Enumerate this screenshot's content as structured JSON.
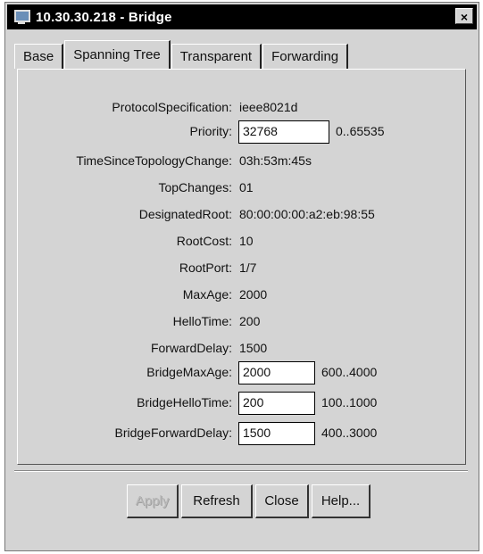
{
  "window": {
    "title": "10.30.30.218 - Bridge",
    "close_label": "×"
  },
  "tabs": [
    {
      "label": "Base"
    },
    {
      "label": "Spanning Tree",
      "active": true
    },
    {
      "label": "Transparent"
    },
    {
      "label": "Forwarding"
    }
  ],
  "fields": {
    "protocol_specification": {
      "label": "ProtocolSpecification:",
      "value": "ieee8021d"
    },
    "priority": {
      "label": "Priority:",
      "value": "32768",
      "range": "0..65535"
    },
    "time_since_topology_change": {
      "label": "TimeSinceTopologyChange:",
      "value": "03h:53m:45s"
    },
    "top_changes": {
      "label": "TopChanges:",
      "value": "01"
    },
    "designated_root": {
      "label": "DesignatedRoot:",
      "value": "80:00:00:00:a2:eb:98:55"
    },
    "root_cost": {
      "label": "RootCost:",
      "value": "10"
    },
    "root_port": {
      "label": "RootPort:",
      "value": "1/7"
    },
    "max_age": {
      "label": "MaxAge:",
      "value": "2000"
    },
    "hello_time": {
      "label": "HelloTime:",
      "value": "200"
    },
    "forward_delay": {
      "label": "ForwardDelay:",
      "value": "1500"
    },
    "bridge_max_age": {
      "label": "BridgeMaxAge:",
      "value": "2000",
      "range": "600..4000"
    },
    "bridge_hello_time": {
      "label": "BridgeHelloTime:",
      "value": "200",
      "range": "100..1000"
    },
    "bridge_forward_delay": {
      "label": "BridgeForwardDelay:",
      "value": "1500",
      "range": "400..3000"
    }
  },
  "buttons": {
    "apply": {
      "label": "Apply",
      "disabled": true
    },
    "refresh": {
      "label": "Refresh"
    },
    "close": {
      "label": "Close"
    },
    "help": {
      "label": "Help..."
    }
  }
}
